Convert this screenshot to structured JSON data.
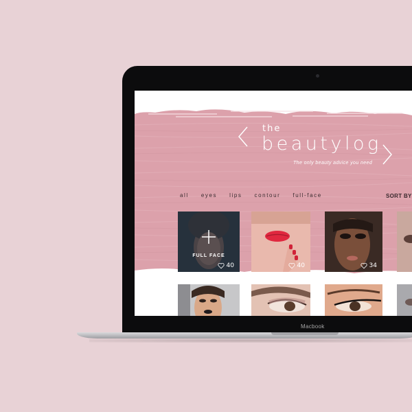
{
  "device": {
    "label": "Macbook"
  },
  "site": {
    "logo_the": "the",
    "logo_main": "beautylog",
    "tagline": "The only beauty advice you need",
    "prev_icon": "chevron-left-icon",
    "next_icon": "chevron-right-icon"
  },
  "nav": {
    "items": [
      {
        "label": "all"
      },
      {
        "label": "eyes"
      },
      {
        "label": "lips"
      },
      {
        "label": "contour"
      },
      {
        "label": "full-face"
      }
    ],
    "sort_label": "SORT BY"
  },
  "cards": [
    {
      "category": "FULL FACE",
      "likes": "40",
      "icon": "plus-icon"
    },
    {
      "likes": "40"
    },
    {
      "likes": "34"
    }
  ],
  "colors": {
    "background": "#e8d2d6",
    "hero_pink": "#dca1ab",
    "text_dark": "#3a2a2e"
  }
}
